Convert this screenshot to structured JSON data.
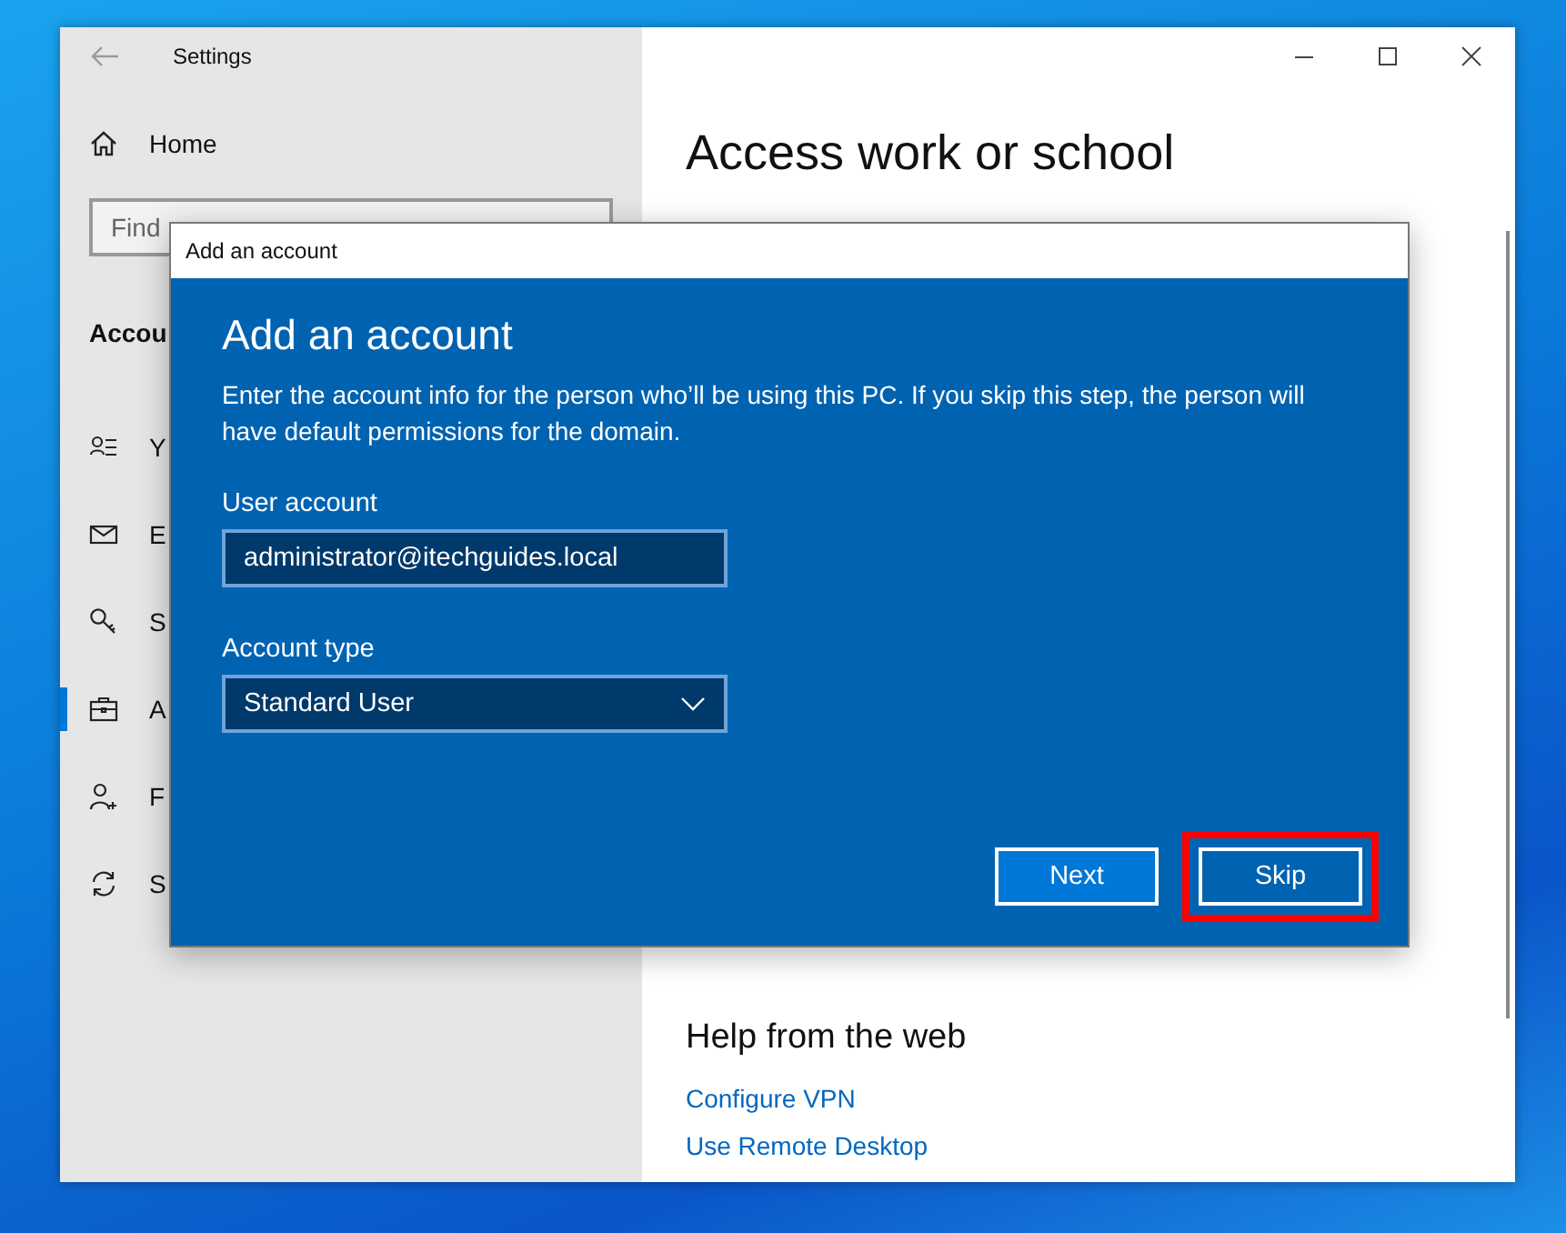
{
  "window": {
    "title": "Settings"
  },
  "sidebar": {
    "home": "Home",
    "search": {
      "placeholder": "Find"
    },
    "section": "Accou",
    "items": [
      {
        "label": "Y",
        "selected": false
      },
      {
        "label": "E",
        "selected": false
      },
      {
        "label": "S",
        "selected": false
      },
      {
        "label": "A",
        "selected": true
      },
      {
        "label": "F",
        "selected": false
      },
      {
        "label": "S",
        "selected": false
      }
    ]
  },
  "content": {
    "title": "Access work or school",
    "help_heading": "Help from the web",
    "links": [
      "Configure VPN",
      "Use Remote Desktop"
    ]
  },
  "dialog": {
    "title": "Add an account",
    "heading": "Add an account",
    "description": "Enter the account info for the person who’ll be using this PC. If you skip this step, the person will have default permissions for the domain.",
    "fields": [
      {
        "label": "User account",
        "kind": "text",
        "value": "administrator@itechguides.local"
      },
      {
        "label": "Account type",
        "kind": "dropdown",
        "value": "Standard User"
      }
    ],
    "buttons": [
      {
        "label": "Next",
        "highlighted": false
      },
      {
        "label": "Skip",
        "highlighted": true
      }
    ]
  }
}
